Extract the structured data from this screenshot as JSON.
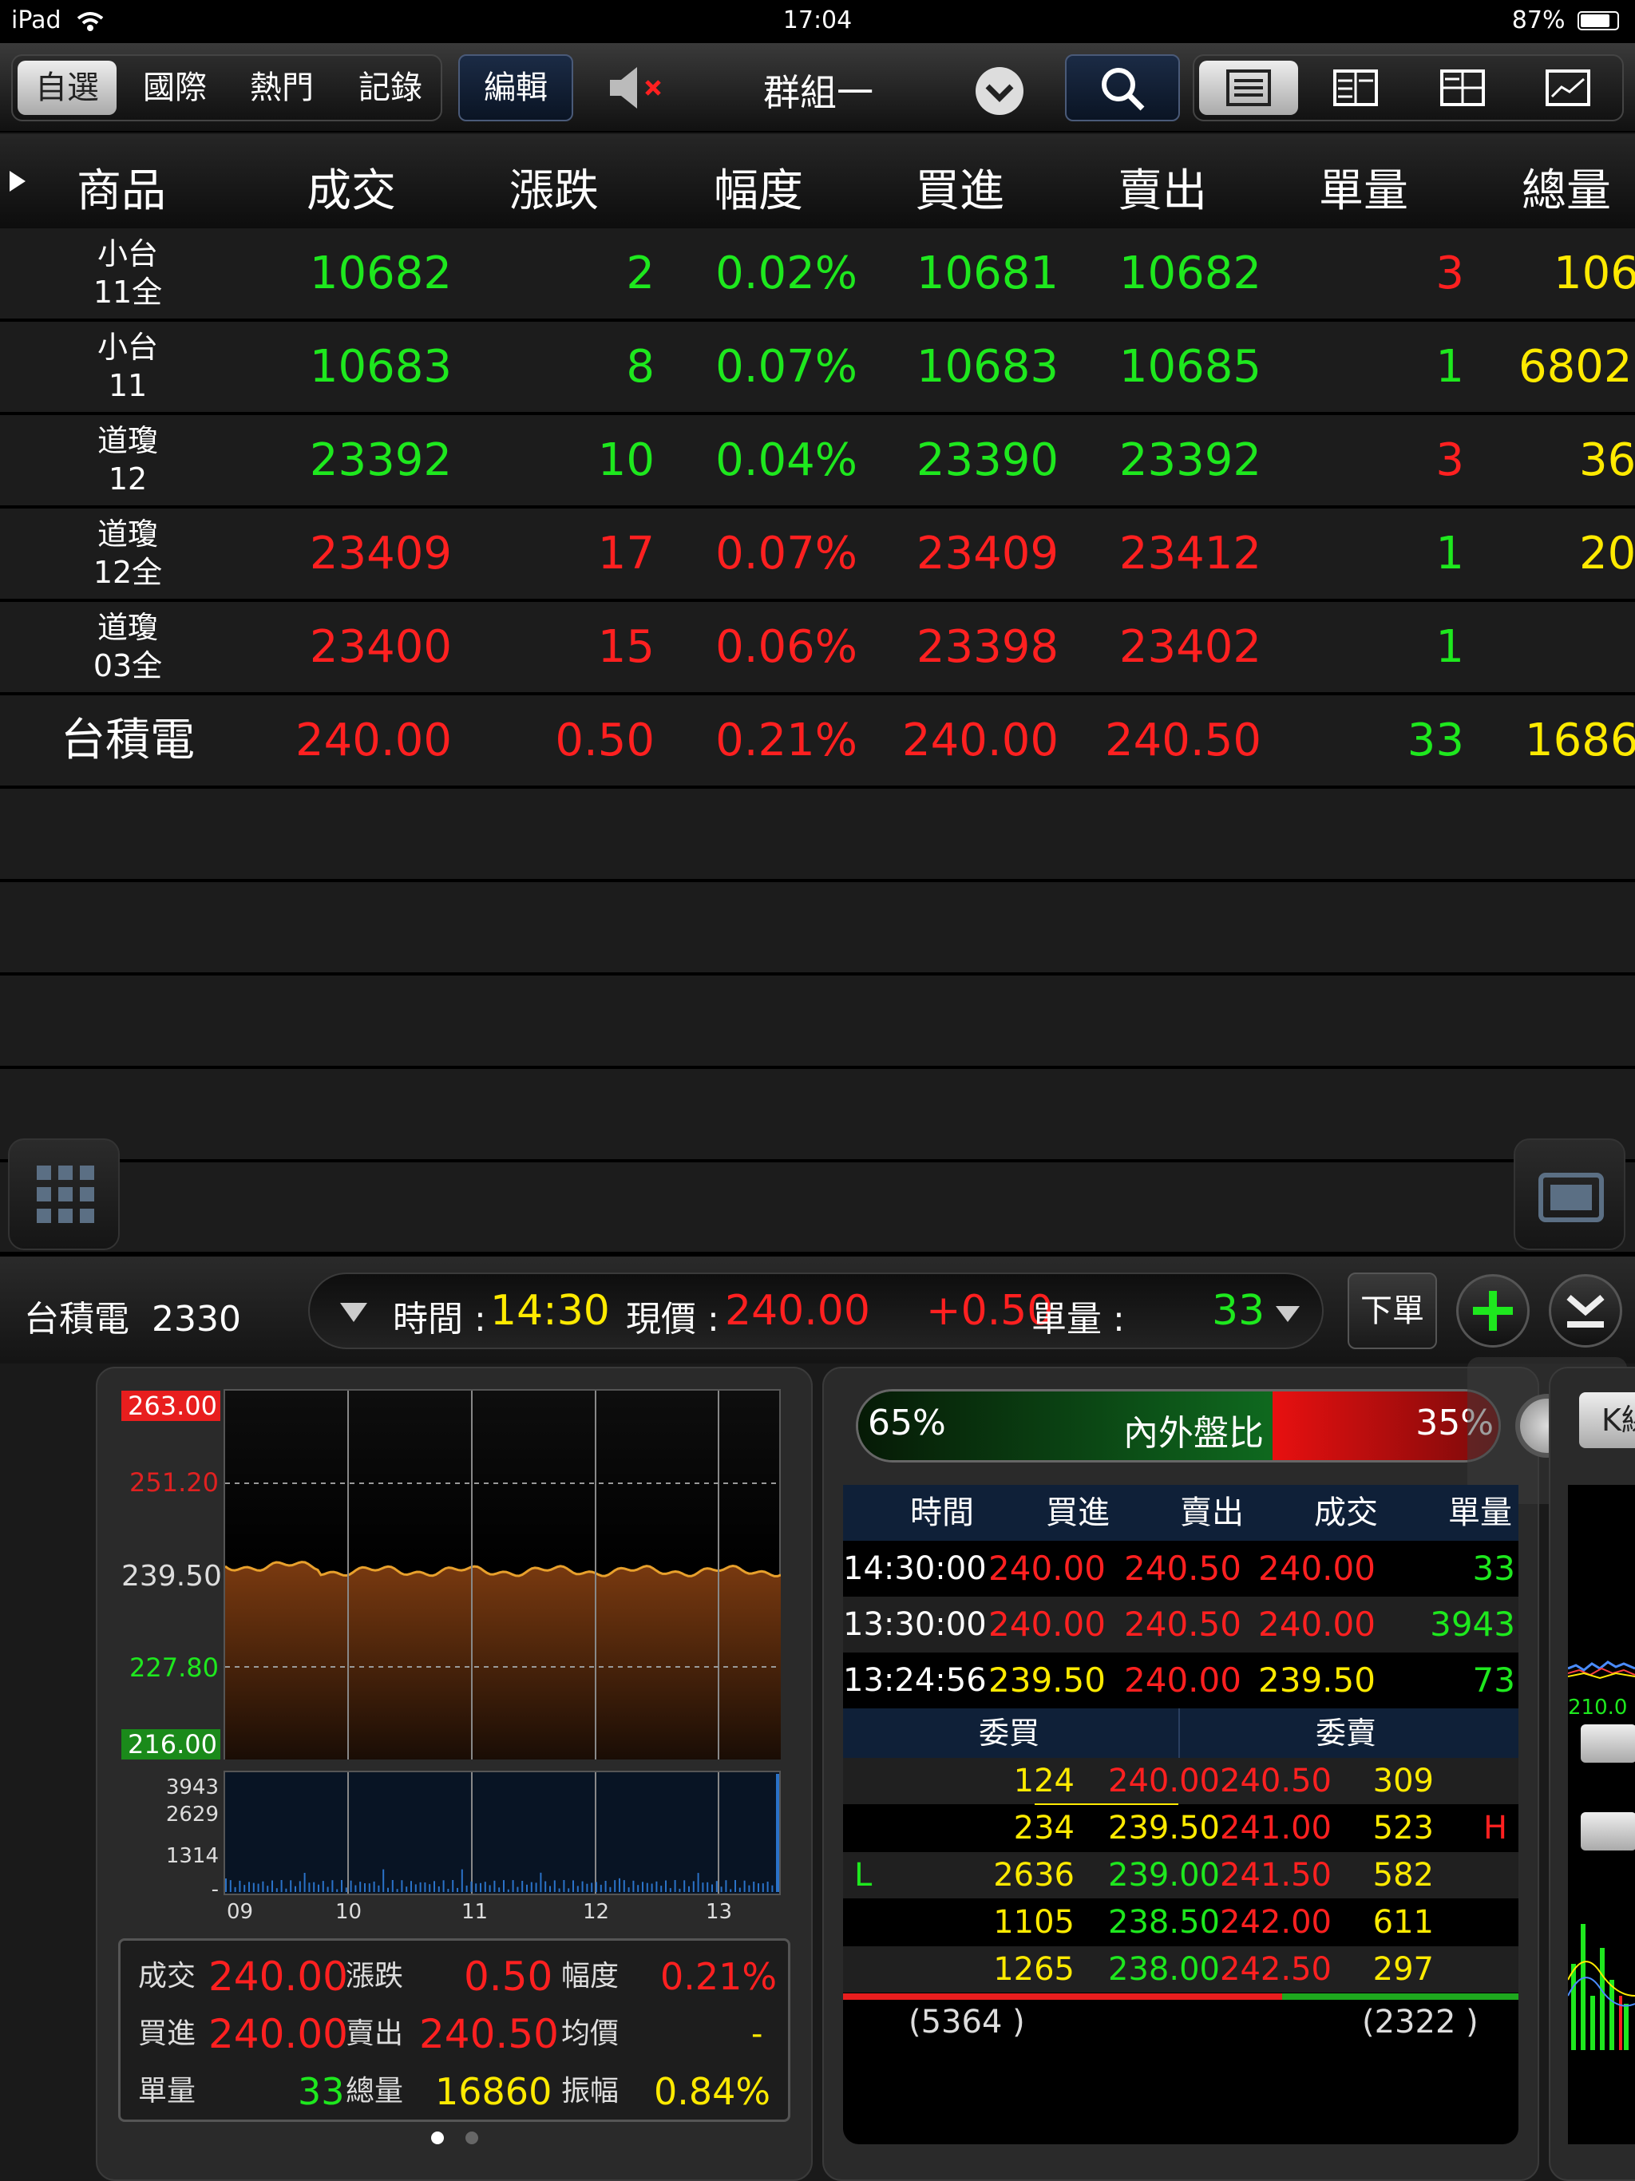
{
  "status_bar": {
    "device": "iPad",
    "time": "17:04",
    "battery": "87%"
  },
  "toolbar": {
    "tabs": [
      "自選",
      "國際",
      "熱門",
      "記錄"
    ],
    "edit_label": "編輯",
    "group_label": "群組一"
  },
  "table": {
    "headers": [
      "商品",
      "成交",
      "漲跌",
      "幅度",
      "買進",
      "賣出",
      "單量",
      "總量"
    ],
    "rows": [
      {
        "name_line1": "小台",
        "name_line2": "11全",
        "price": "10682",
        "change": "2",
        "pct": "0.02%",
        "bid": "10681",
        "ask": "10682",
        "vol": "3",
        "total": "106"
      },
      {
        "name_line1": "小台",
        "name_line2": "11",
        "price": "10683",
        "change": "8",
        "pct": "0.07%",
        "bid": "10683",
        "ask": "10685",
        "vol": "1",
        "total": "6802"
      },
      {
        "name_line1": "道瓊",
        "name_line2": "12",
        "price": "23392",
        "change": "10",
        "pct": "0.04%",
        "bid": "23390",
        "ask": "23392",
        "vol": "3",
        "total": "36"
      },
      {
        "name_line1": "道瓊",
        "name_line2": "12全",
        "price": "23409",
        "change": "17",
        "pct": "0.07%",
        "bid": "23409",
        "ask": "23412",
        "vol": "1",
        "total": "20"
      },
      {
        "name_line1": "道瓊",
        "name_line2": "03全",
        "price": "23400",
        "change": "15",
        "pct": "0.06%",
        "bid": "23398",
        "ask": "23402",
        "vol": "1",
        "total": ""
      },
      {
        "name": "台積電",
        "price": "240.00",
        "change": "0.50",
        "pct": "0.21%",
        "bid": "240.00",
        "ask": "240.50",
        "vol": "33",
        "total": "1686"
      }
    ]
  },
  "infobar": {
    "symbol": "台積電  2330",
    "time_label": "時間 :",
    "time_value": "14:30",
    "price_label": "現價 :",
    "price_value": "240.00",
    "change_value": "+0.50",
    "vol_label": "單量 :",
    "vol_value": "33",
    "order_label": "下單"
  },
  "chart": {
    "y_labels": [
      "263.00",
      "251.20",
      "239.50",
      "227.80",
      "216.00"
    ],
    "vol_labels": [
      "3943",
      "2629",
      "1314",
      "-"
    ],
    "x_labels": [
      "09",
      "10",
      "11",
      "12",
      "13"
    ]
  },
  "stats": {
    "r1": {
      "l1": "成交",
      "v1": "240.00",
      "l2": "漲跌",
      "v2": "0.50",
      "l3": "幅度",
      "v3": "0.21%"
    },
    "r2": {
      "l1": "買進",
      "v1": "240.00",
      "l2": "賣出",
      "v2": "240.50",
      "l3": "均價",
      "v3": "-"
    },
    "r3": {
      "l1": "單量",
      "v1": "33",
      "l2": "總量",
      "v2": "16860",
      "l3": "振幅",
      "v3": "0.84%"
    }
  },
  "ratio": {
    "left": "65%",
    "label": "內外盤比",
    "right": "35%",
    "left_fraction": 0.65
  },
  "ticks": {
    "headers": [
      "時間",
      "買進",
      "賣出",
      "成交",
      "單量"
    ],
    "rows": [
      {
        "time": "14:30:00",
        "bid": "240.00",
        "ask": "240.50",
        "price": "240.00",
        "vol": "33"
      },
      {
        "time": "13:30:00",
        "bid": "240.00",
        "ask": "240.50",
        "price": "240.00",
        "vol": "3943"
      },
      {
        "time": "13:24:56",
        "bid": "239.50",
        "ask": "240.00",
        "price": "239.50",
        "vol": "73"
      }
    ]
  },
  "orderbook": {
    "buy_label": "委買",
    "sell_label": "委賣",
    "rows": [
      {
        "mark_l": "",
        "bid_qty": "124",
        "bid": "240.00",
        "ask": "240.50",
        "ask_qty": "309",
        "mark_r": ""
      },
      {
        "mark_l": "",
        "bid_qty": "234",
        "bid": "239.50",
        "ask": "241.00",
        "ask_qty": "523",
        "mark_r": "H"
      },
      {
        "mark_l": "L",
        "bid_qty": "2636",
        "bid": "239.00",
        "ask": "241.50",
        "ask_qty": "582",
        "mark_r": ""
      },
      {
        "mark_l": "",
        "bid_qty": "1105",
        "bid": "238.50",
        "ask": "242.00",
        "ask_qty": "611",
        "mark_r": ""
      },
      {
        "mark_l": "",
        "bid_qty": "1265",
        "bid": "238.00",
        "ask": "242.50",
        "ask_qty": "297",
        "mark_r": ""
      }
    ],
    "total_buy": "(5364 )",
    "total_sell": "(2322 )"
  },
  "right_panel": {
    "tab_label": "K線",
    "axis_label": "210.0"
  },
  "colors": {
    "up": "#ff2020",
    "down": "#1ee81e",
    "volume": "#ffea00",
    "accent": "#4a8cff"
  }
}
